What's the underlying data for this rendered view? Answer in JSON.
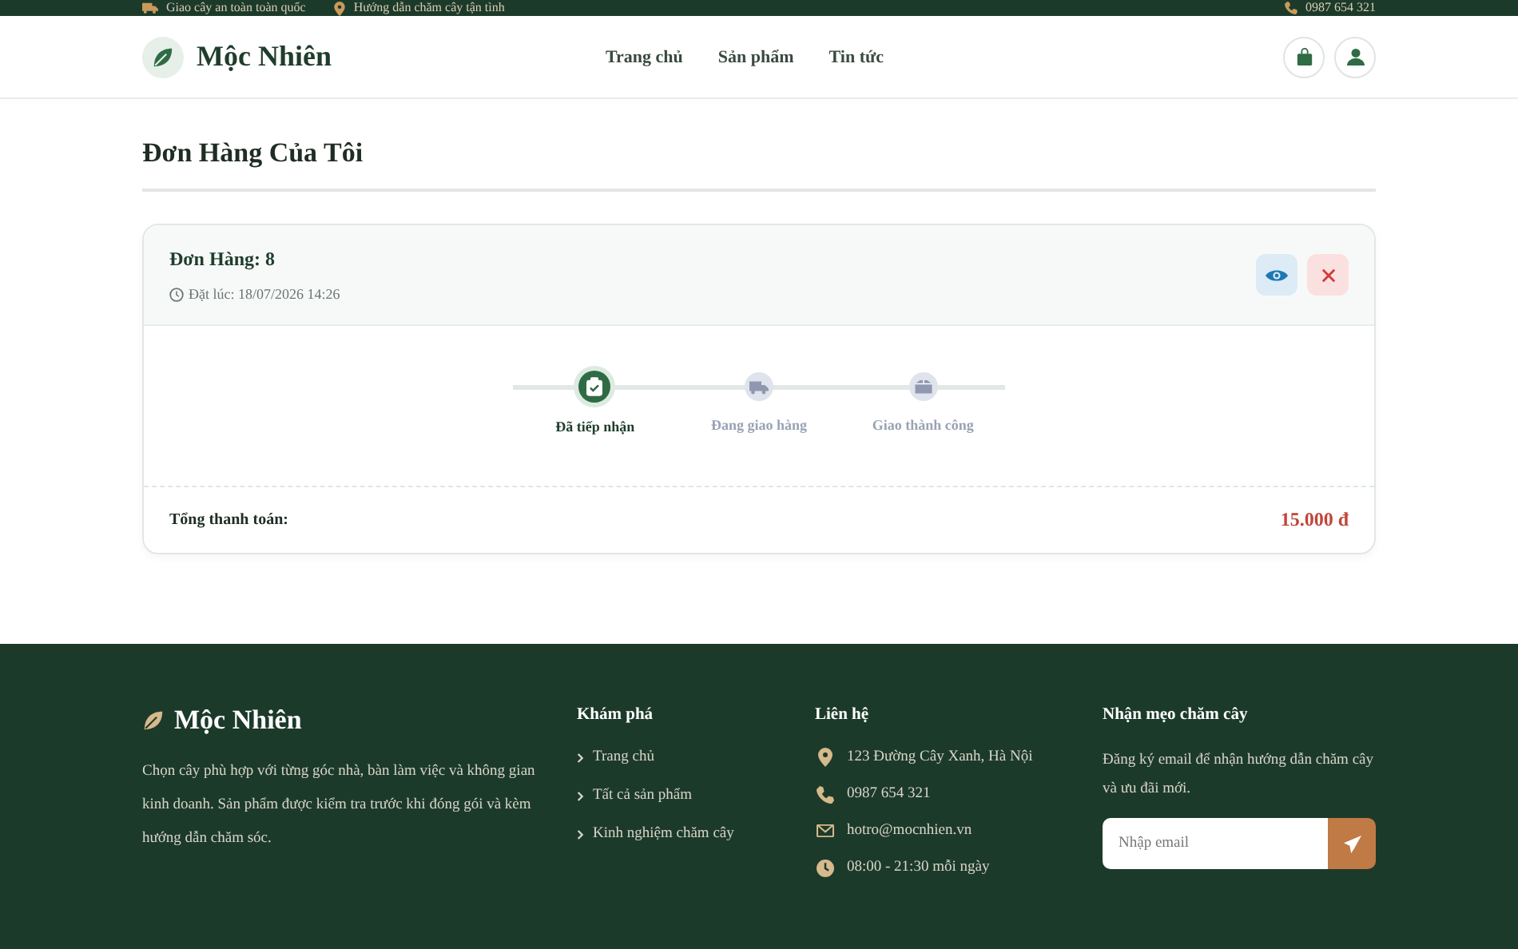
{
  "topbar": {
    "items": [
      {
        "kind": "truck",
        "text": "Giao cây an toàn toàn quốc"
      },
      {
        "kind": "pin",
        "text": "Hướng dẫn chăm cây tận tình"
      }
    ],
    "phone": "0987 654 321"
  },
  "header": {
    "brand": "Mộc Nhiên",
    "nav": [
      {
        "label": "Trang chủ"
      },
      {
        "label": "Sản phẩm"
      },
      {
        "label": "Tin tức"
      }
    ]
  },
  "page_title": "Đơn Hàng Của Tôi",
  "orders": [
    {
      "title": "Đơn Hàng: 8",
      "placed": "Đặt lúc: 18/07/2026 14:26",
      "steps": [
        {
          "kind": "received",
          "label": "Đã tiếp nhận",
          "done": true
        },
        {
          "kind": "shipping",
          "label": "Đang giao hàng",
          "done": false
        },
        {
          "kind": "delivered",
          "label": "Giao thành công",
          "done": false
        }
      ],
      "total_label": "Tổng thanh toán:",
      "total": "15.000 đ"
    }
  ],
  "footer": {
    "brand": "Mộc Nhiên",
    "about": "Chọn cây phù hợp với từng góc nhà, bàn làm việc và không gian kinh doanh. Sản phẩm được kiểm tra trước khi đóng gói và kèm hướng dẫn chăm sóc.",
    "explore": {
      "title": "Khám phá",
      "links": [
        {
          "label": "Trang chủ"
        },
        {
          "label": "Tất cả sản phẩm"
        },
        {
          "label": "Kinh nghiệm chăm cây"
        }
      ]
    },
    "contact": {
      "title": "Liên hệ",
      "items": [
        {
          "kind": "address",
          "text": "123 Đường Cây Xanh, Hà Nội"
        },
        {
          "kind": "phone",
          "text": "0987 654 321"
        },
        {
          "kind": "email",
          "text": "hotro@mocnhien.vn"
        },
        {
          "kind": "hours",
          "text": "08:00 - 21:30 mỗi ngày"
        }
      ]
    },
    "newsletter": {
      "title": "Nhận mẹo chăm cây",
      "text": "Đăng ký email để nhận hướng dẫn chăm cây và ưu đãi mới.",
      "placeholder": "Nhập email"
    }
  }
}
